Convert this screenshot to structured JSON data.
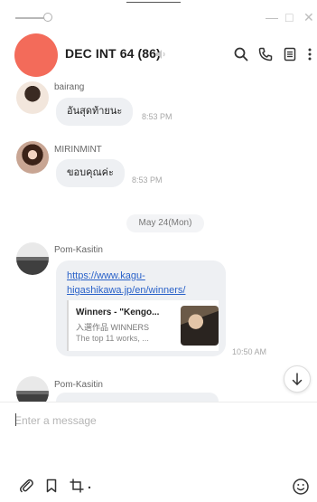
{
  "window": {
    "minimize_glyph": "—",
    "restore_glyph": "□",
    "close_glyph": "✕"
  },
  "header": {
    "title": "DEC INT 64 (86)",
    "avatar_color": "#f36b5a",
    "icons": [
      "mute-icon",
      "search-icon",
      "phone-icon",
      "notes-icon",
      "more-icon"
    ]
  },
  "messages": [
    {
      "sender": "bairang",
      "text": "อันสุดท้ายนะ",
      "time": "8:53 PM"
    },
    {
      "sender": "MIRINMINT",
      "text": "ขอบคุณค่ะ",
      "time": "8:53 PM"
    },
    {
      "date_divider": "May 24(Mon)"
    },
    {
      "sender": "Pom-Kasitin",
      "link_line1": "https://www.kagu-",
      "link_line2": "higashikawa.jp/en/winners/",
      "preview": {
        "title": "Winners - \"Kengo...",
        "subtitle": "入選作品 WINNERS",
        "description": "The top 11 works, ..."
      },
      "time": "10:50 AM"
    },
    {
      "sender": "Pom-Kasitin"
    }
  ],
  "composer": {
    "placeholder": "Enter a message",
    "tools": [
      "paperclip-icon",
      "bookmark-icon",
      "crop-icon",
      "emoji-icon"
    ]
  },
  "colors": {
    "link": "#2a62c9",
    "bubble": "#eef0f3"
  }
}
